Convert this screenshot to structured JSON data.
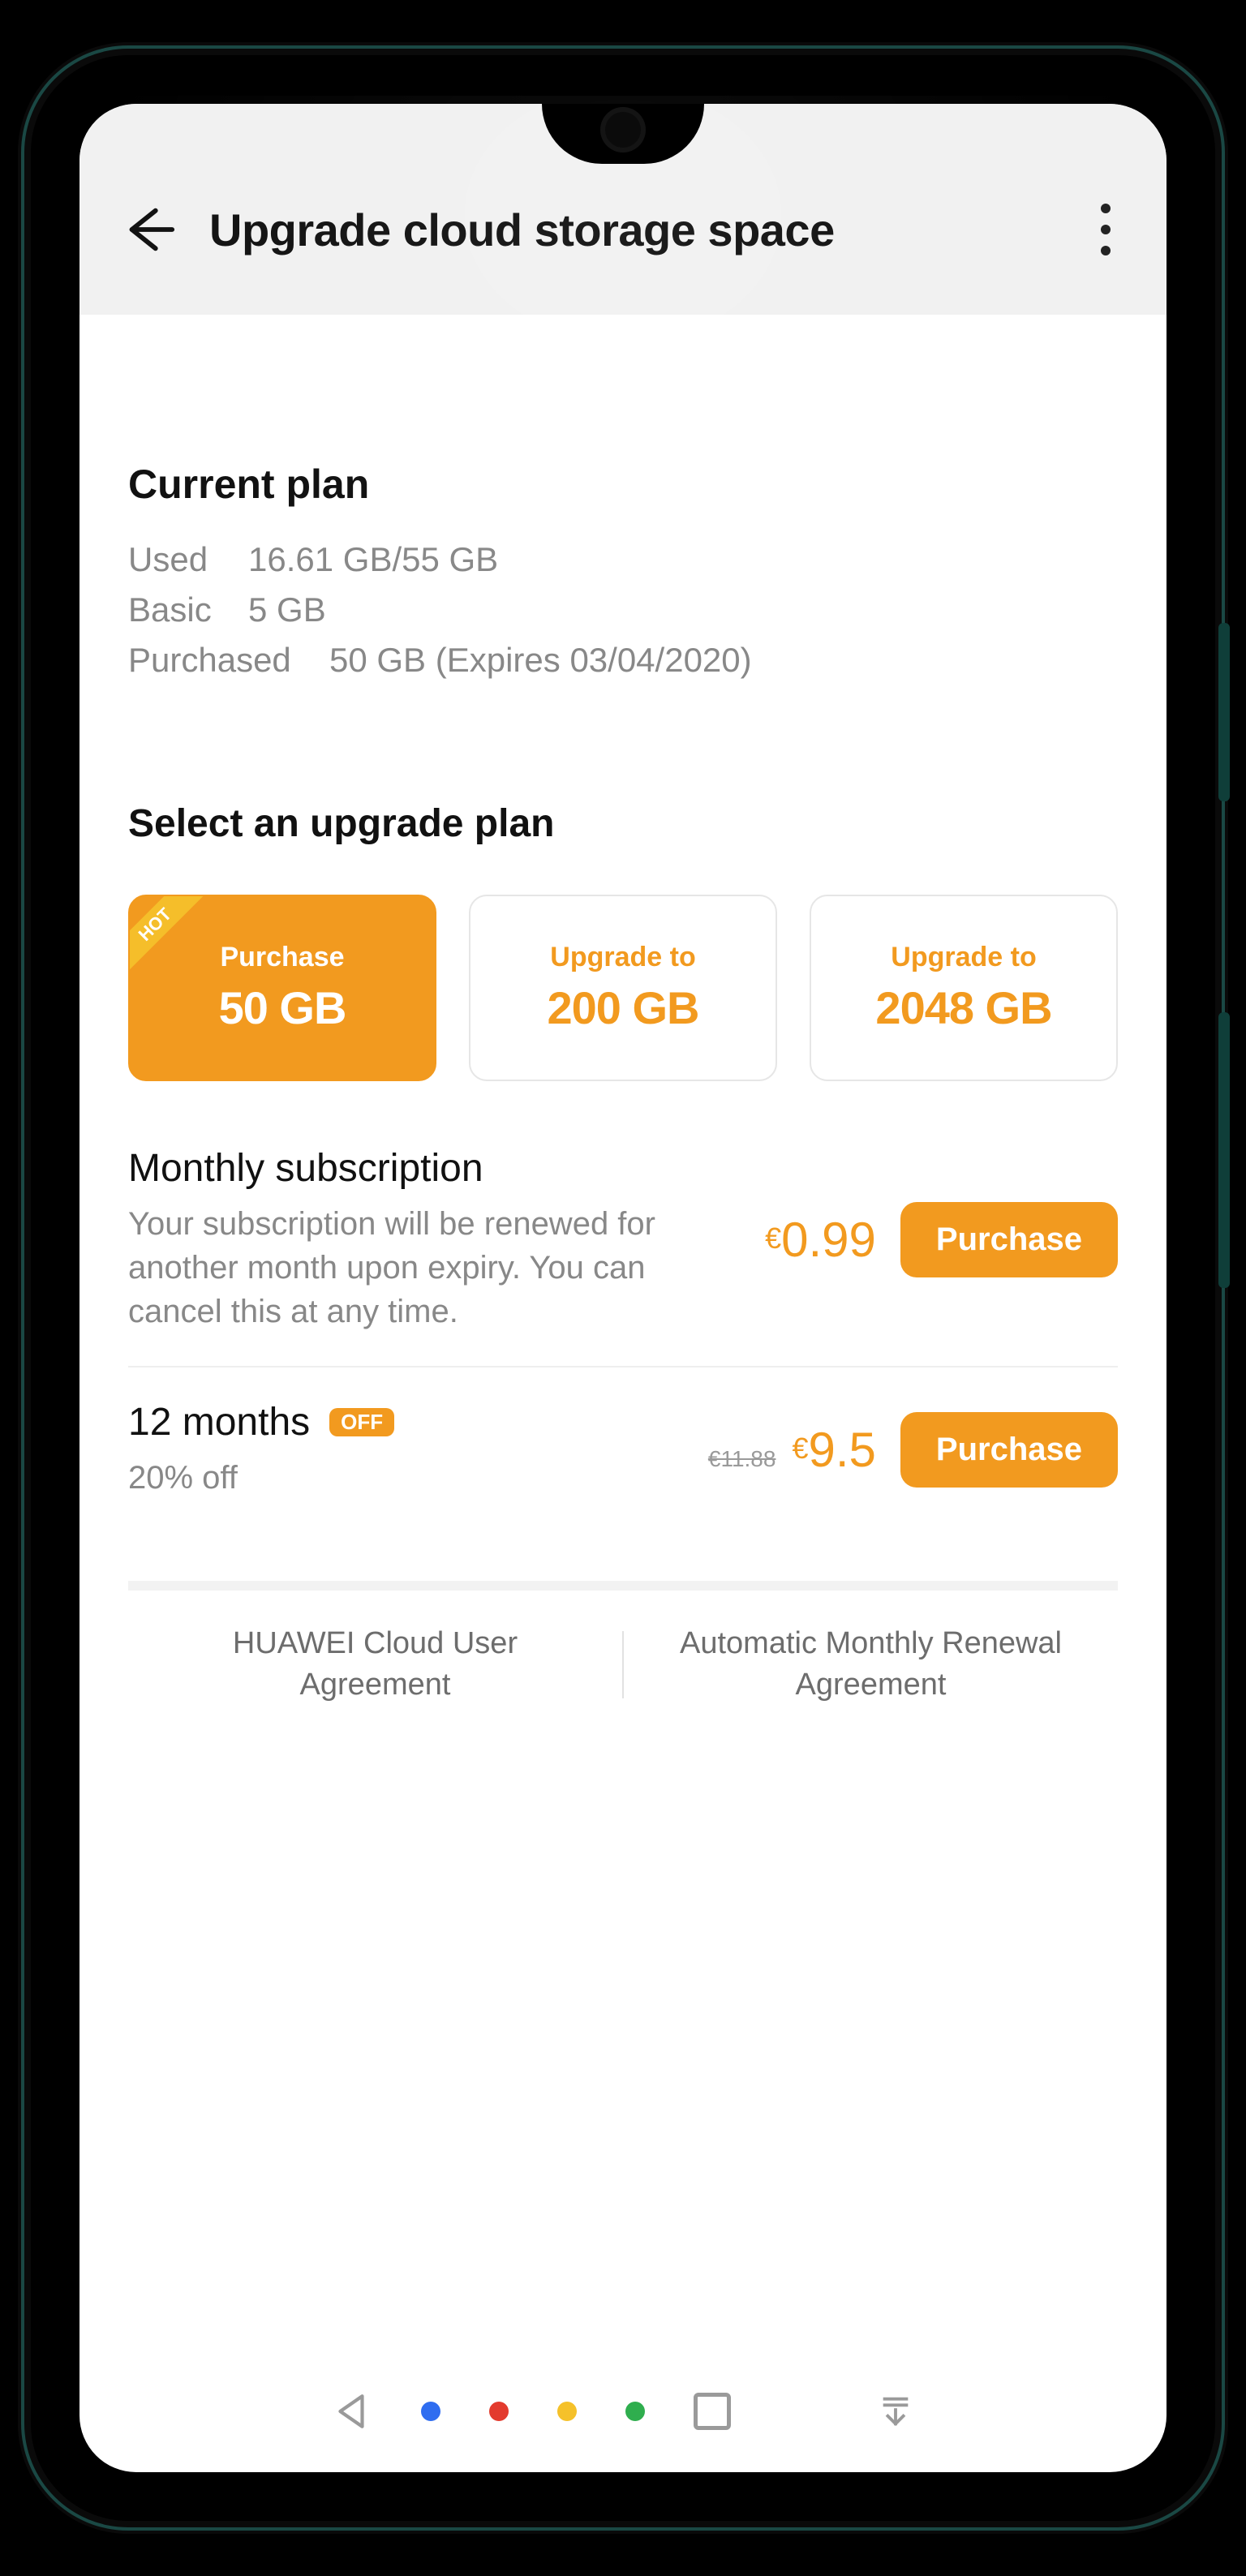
{
  "header": {
    "title": "Upgrade cloud storage space"
  },
  "current_plan": {
    "heading": "Current plan",
    "used_label": "Used",
    "used_value": "16.61 GB/55 GB",
    "basic_label": "Basic",
    "basic_value": "5 GB",
    "purchased_label": "Purchased",
    "purchased_value": "50 GB (Expires 03/04/2020)"
  },
  "select_plan": {
    "heading": "Select an upgrade plan",
    "hot_badge": "HOT",
    "plans": [
      {
        "action": "Purchase",
        "size": "50 GB",
        "selected": true,
        "hot": true
      },
      {
        "action": "Upgrade to",
        "size": "200 GB",
        "selected": false,
        "hot": false
      },
      {
        "action": "Upgrade to",
        "size": "2048 GB",
        "selected": false,
        "hot": false
      }
    ]
  },
  "monthly": {
    "title": "Monthly subscription",
    "description": "Your subscription will be renewed for another month upon expiry. You can cancel this at any time.",
    "currency": "€",
    "price": "0.99",
    "button": "Purchase"
  },
  "yearly": {
    "title": "12 months",
    "off_badge": "OFF",
    "discount": "20% off",
    "old_price": "€11.88",
    "currency": "€",
    "price": "9.5",
    "button": "Purchase"
  },
  "footer": {
    "link1": "HUAWEI Cloud User Agreement",
    "link2": "Automatic Monthly Renewal Agreement"
  }
}
